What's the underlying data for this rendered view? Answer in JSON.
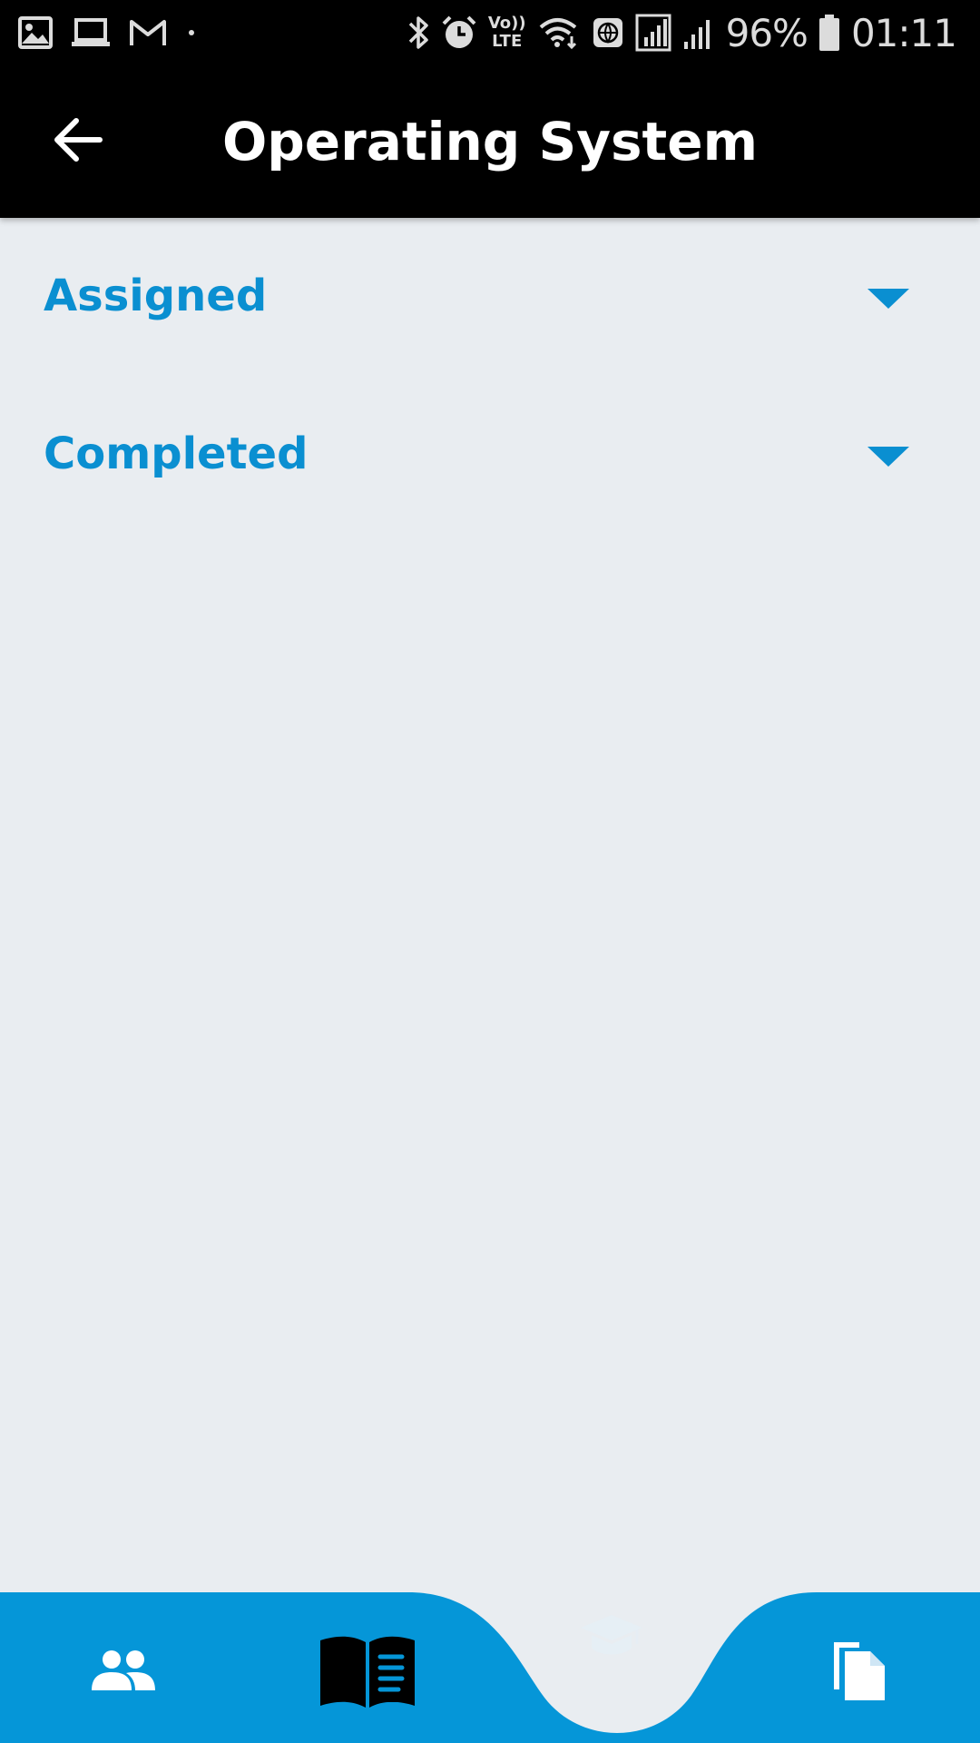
{
  "status_bar": {
    "battery_percent": "96%",
    "time": "01:11",
    "icons_left": [
      "gallery-icon",
      "laptop-icon",
      "gmail-icon",
      "dot-icon"
    ],
    "icons_right": [
      "bluetooth-icon",
      "alarm-icon",
      "volte-icon",
      "wifi-icon",
      "globe-icon",
      "signal-icon",
      "signal-icon",
      "battery-icon"
    ],
    "volte_label_top": "Vo))",
    "volte_label_bottom": "LTE"
  },
  "app_bar": {
    "title": "Operating System",
    "back_icon": "arrow-left-icon"
  },
  "sections": [
    {
      "label": "Assigned",
      "icon": "chevron-down-icon"
    },
    {
      "label": "Completed",
      "icon": "chevron-down-icon"
    }
  ],
  "bottom_nav": {
    "items": [
      {
        "icon": "people-icon"
      },
      {
        "icon": "book-icon"
      },
      {
        "icon": "graduation-cap-icon"
      },
      {
        "icon": "files-icon"
      }
    ]
  },
  "colors": {
    "accent": "#0a8fd1",
    "nav_background": "#0596d8",
    "app_bar": "#000000",
    "page_background": "#e9edf1"
  }
}
